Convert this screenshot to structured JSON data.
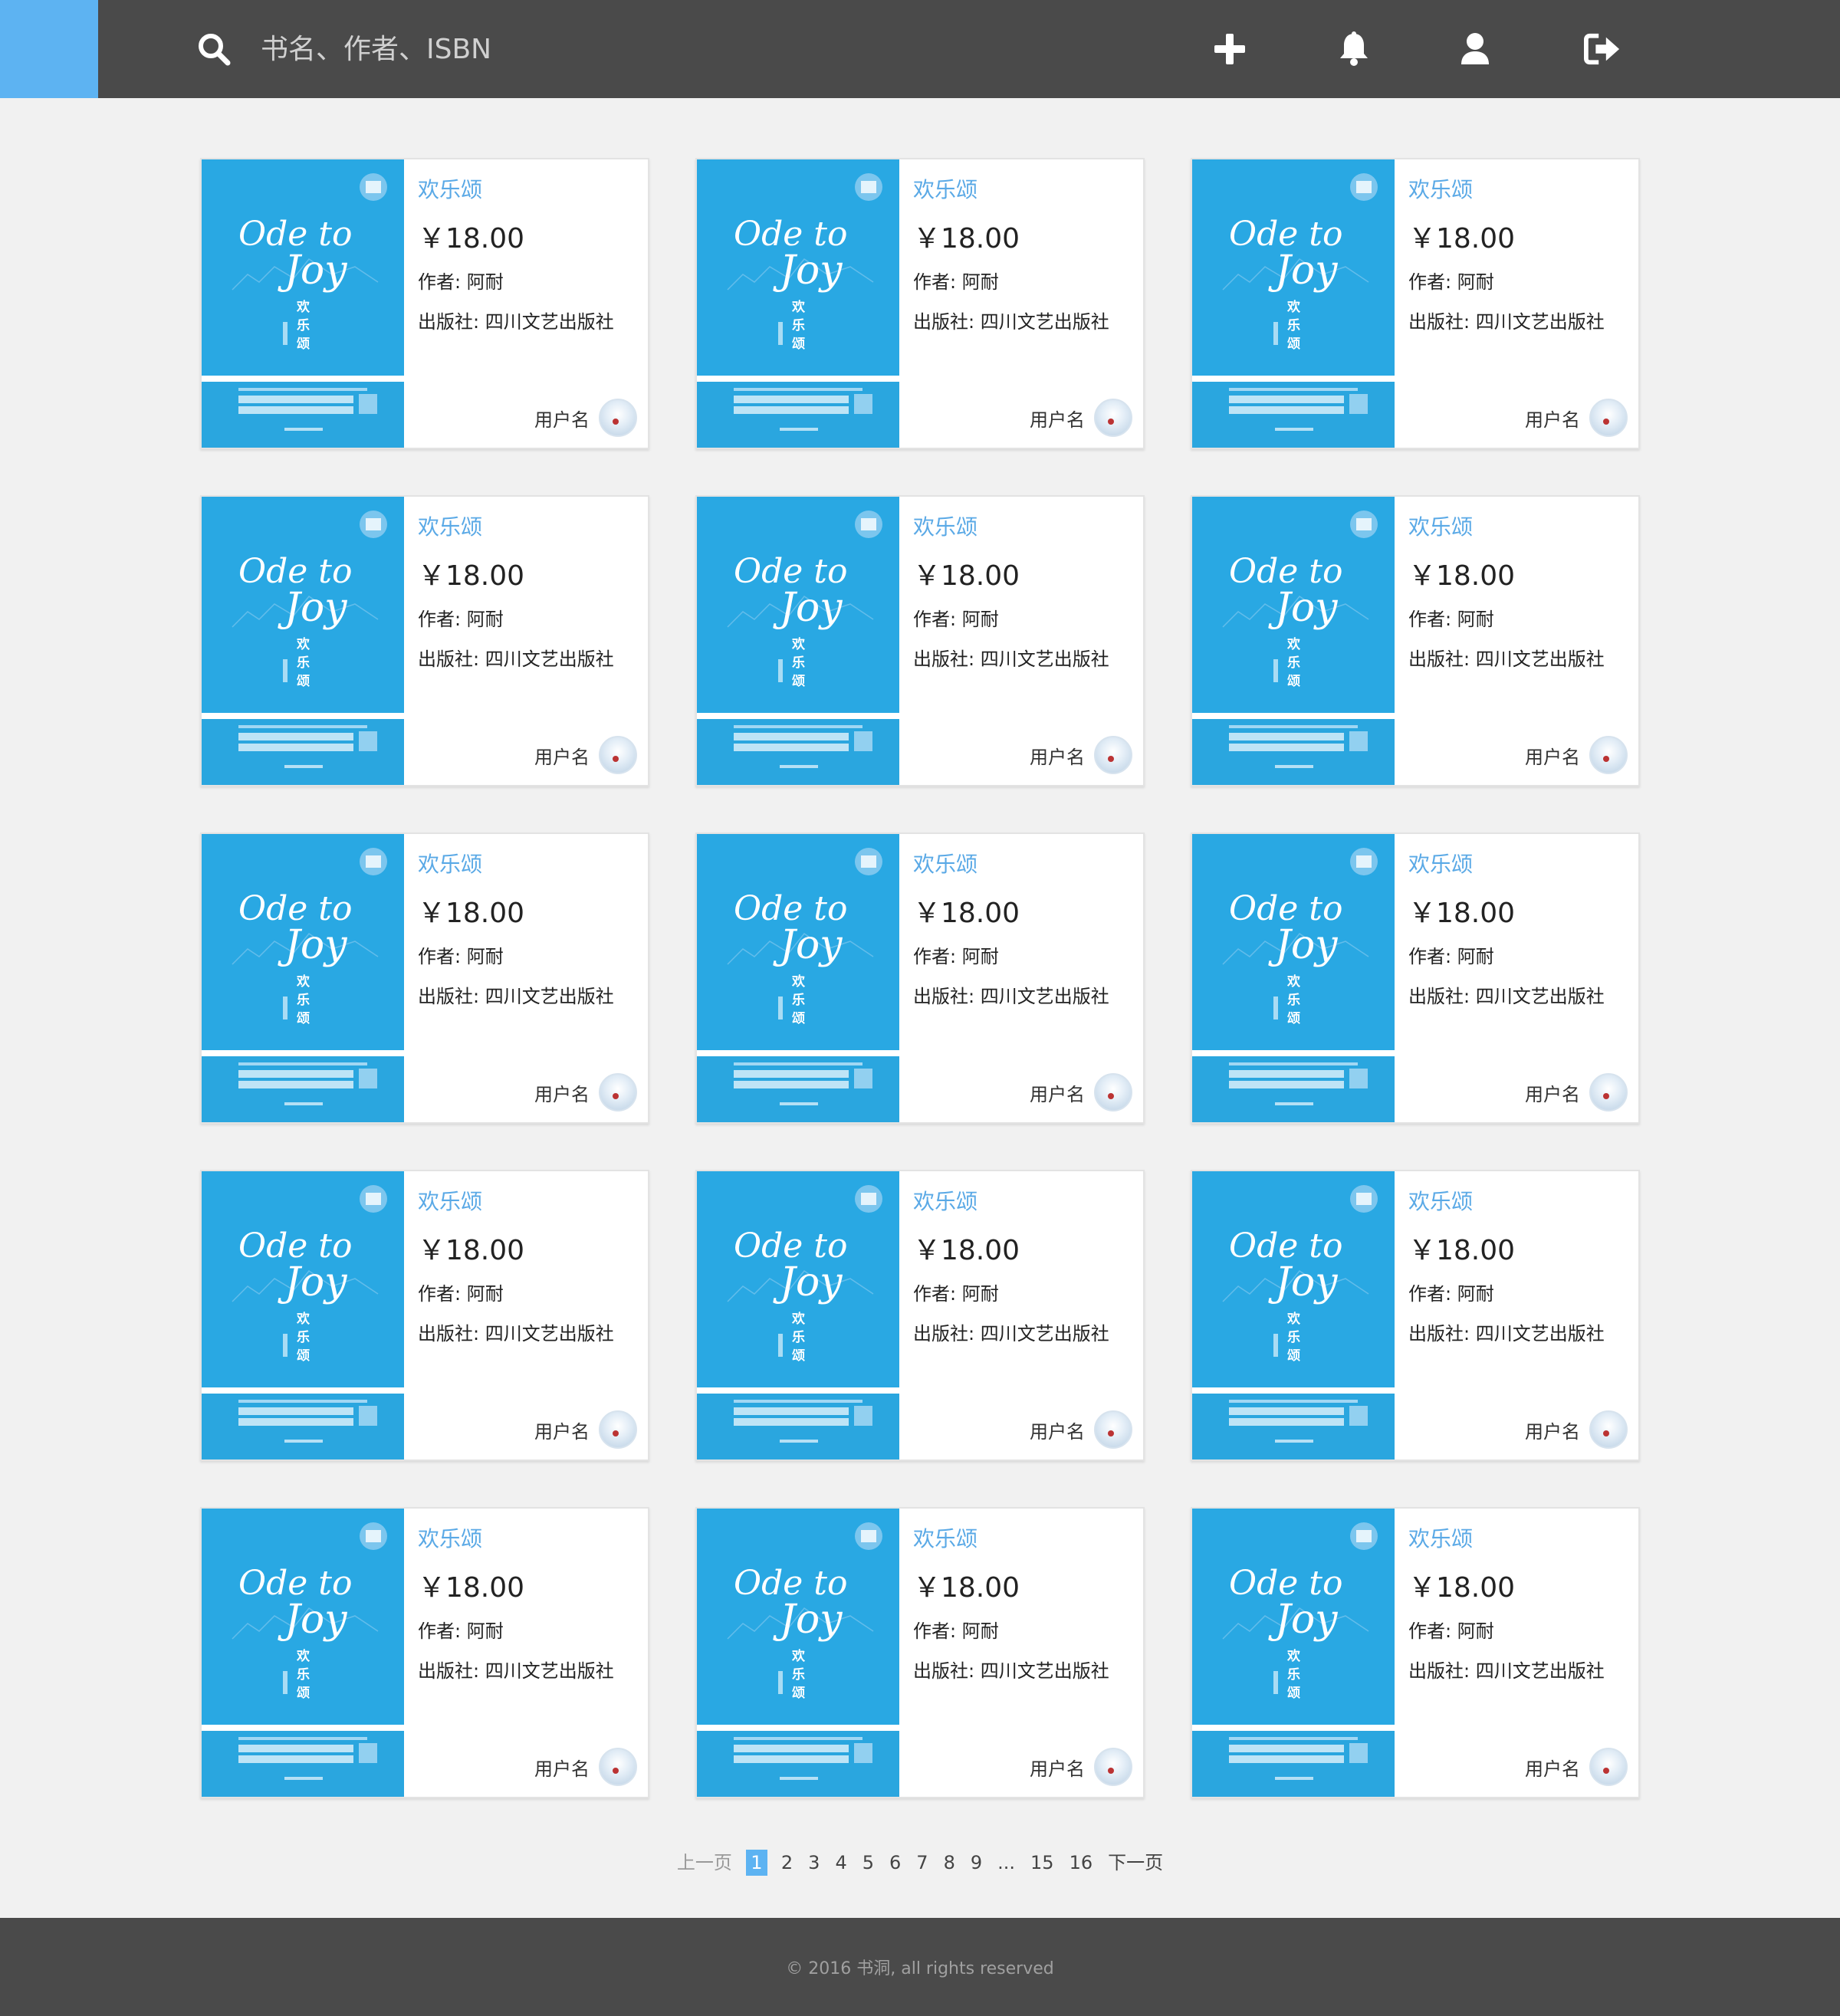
{
  "header": {
    "search_placeholder": "书名、作者、ISBN",
    "icons": [
      "search-icon",
      "add-icon",
      "bell-icon",
      "user-icon",
      "logout-icon"
    ]
  },
  "colors": {
    "topbar": "#4a4a4a",
    "accent": "#5db3f2",
    "cover_blue": "#29a8e3",
    "title_blue": "#5aa9e6"
  },
  "books": [
    {
      "title": "欢乐颂",
      "price": "￥18.00",
      "author": "作者:  阿耐",
      "publisher": "出版社: 四川文艺出版社",
      "owner": "用户名"
    },
    {
      "title": "欢乐颂",
      "price": "￥18.00",
      "author": "作者:  阿耐",
      "publisher": "出版社: 四川文艺出版社",
      "owner": "用户名"
    },
    {
      "title": "欢乐颂",
      "price": "￥18.00",
      "author": "作者:  阿耐",
      "publisher": "出版社: 四川文艺出版社",
      "owner": "用户名"
    },
    {
      "title": "欢乐颂",
      "price": "￥18.00",
      "author": "作者:  阿耐",
      "publisher": "出版社: 四川文艺出版社",
      "owner": "用户名"
    },
    {
      "title": "欢乐颂",
      "price": "￥18.00",
      "author": "作者:  阿耐",
      "publisher": "出版社: 四川文艺出版社",
      "owner": "用户名"
    },
    {
      "title": "欢乐颂",
      "price": "￥18.00",
      "author": "作者:  阿耐",
      "publisher": "出版社: 四川文艺出版社",
      "owner": "用户名"
    },
    {
      "title": "欢乐颂",
      "price": "￥18.00",
      "author": "作者:  阿耐",
      "publisher": "出版社: 四川文艺出版社",
      "owner": "用户名"
    },
    {
      "title": "欢乐颂",
      "price": "￥18.00",
      "author": "作者:  阿耐",
      "publisher": "出版社: 四川文艺出版社",
      "owner": "用户名"
    },
    {
      "title": "欢乐颂",
      "price": "￥18.00",
      "author": "作者:  阿耐",
      "publisher": "出版社: 四川文艺出版社",
      "owner": "用户名"
    },
    {
      "title": "欢乐颂",
      "price": "￥18.00",
      "author": "作者:  阿耐",
      "publisher": "出版社: 四川文艺出版社",
      "owner": "用户名"
    },
    {
      "title": "欢乐颂",
      "price": "￥18.00",
      "author": "作者:  阿耐",
      "publisher": "出版社: 四川文艺出版社",
      "owner": "用户名"
    },
    {
      "title": "欢乐颂",
      "price": "￥18.00",
      "author": "作者:  阿耐",
      "publisher": "出版社: 四川文艺出版社",
      "owner": "用户名"
    },
    {
      "title": "欢乐颂",
      "price": "￥18.00",
      "author": "作者:  阿耐",
      "publisher": "出版社: 四川文艺出版社",
      "owner": "用户名"
    },
    {
      "title": "欢乐颂",
      "price": "￥18.00",
      "author": "作者:  阿耐",
      "publisher": "出版社: 四川文艺出版社",
      "owner": "用户名"
    },
    {
      "title": "欢乐颂",
      "price": "￥18.00",
      "author": "作者:  阿耐",
      "publisher": "出版社: 四川文艺出版社",
      "owner": "用户名"
    }
  ],
  "cover_art": {
    "script_line1": "Ode to",
    "script_line2": "Joy",
    "title_chars": [
      "欢",
      "乐",
      "颂"
    ]
  },
  "pagination": {
    "prev": "上一页",
    "pages": [
      "1",
      "2",
      "3",
      "4",
      "5",
      "6",
      "7",
      "8",
      "9",
      "...",
      "15",
      "16"
    ],
    "current": "1",
    "next": "下一页"
  },
  "footer": {
    "copyright": "© 2016 书洞, all rights reserved"
  }
}
